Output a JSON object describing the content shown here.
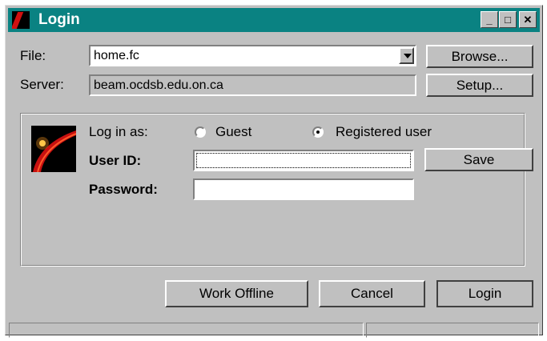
{
  "window": {
    "title": "Login",
    "minimize_glyph": "_",
    "maximize_glyph": "□",
    "close_glyph": "✕"
  },
  "file": {
    "label": "File:",
    "value": "home.fc",
    "browse_button": "Browse..."
  },
  "server": {
    "label": "Server:",
    "value": "beam.ocdsb.edu.on.ca",
    "setup_button": "Setup..."
  },
  "login_as": {
    "label": "Log in as:",
    "options": [
      {
        "label": "Guest",
        "selected": false
      },
      {
        "label": "Registered user",
        "selected": true
      }
    ]
  },
  "user_id": {
    "label": "User ID:",
    "value": "",
    "save_button": "Save"
  },
  "password": {
    "label": "Password:",
    "value": ""
  },
  "buttons": {
    "work_offline": "Work Offline",
    "cancel": "Cancel",
    "login": "Login"
  },
  "icons": {
    "app": "app-logo-icon",
    "brand": "brand-logo-icon"
  },
  "colors": {
    "titlebar": "#0a8282",
    "face": "#c0c0c0"
  }
}
